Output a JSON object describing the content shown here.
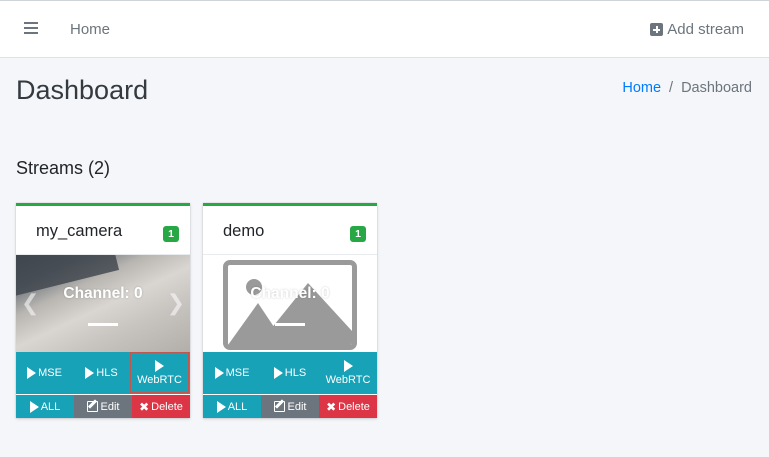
{
  "navbar": {
    "home_label": "Home",
    "add_stream_label": "Add stream"
  },
  "page": {
    "title": "Dashboard",
    "breadcrumb": {
      "home": "Home",
      "separator": "/",
      "current": "Dashboard"
    }
  },
  "streams": {
    "title": "Streams (2)",
    "cards": [
      {
        "name": "my_camera",
        "badge": "1",
        "preview_label": "Channel: 0",
        "buttons": {
          "mse": "MSE",
          "hls": "HLS",
          "webrtc": "WebRTC",
          "all": "ALL",
          "edit": "Edit",
          "delete": "Delete"
        }
      },
      {
        "name": "demo",
        "badge": "1",
        "preview_label": "Channel: 0",
        "buttons": {
          "mse": "MSE",
          "hls": "HLS",
          "webrtc": "WebRTC",
          "all": "ALL",
          "edit": "Edit",
          "delete": "Delete"
        }
      }
    ]
  },
  "colors": {
    "accent_success": "#28a745",
    "info": "#17a2b8",
    "secondary": "#6c757d",
    "danger": "#dc3545",
    "link": "#007bff"
  }
}
